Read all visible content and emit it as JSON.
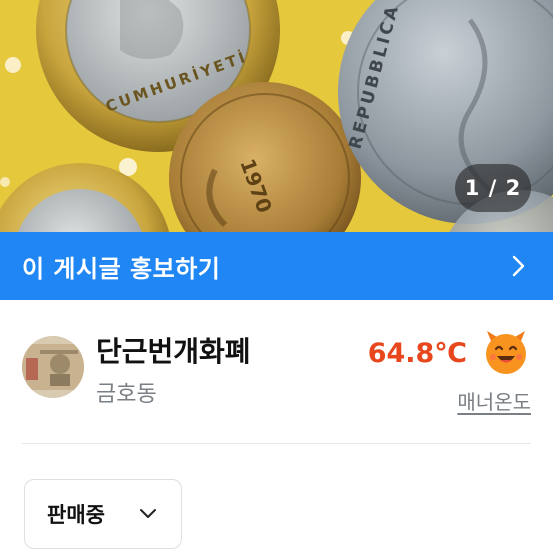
{
  "photo": {
    "counter": "1 / 2",
    "coin_texts": {
      "left_coin": "CUMHURİYETİ",
      "bottom_coin": "1970",
      "right_coin": "REPUBBLICA"
    }
  },
  "promo": {
    "label": "이 게시글 홍보하기",
    "icon": "chevron-right-icon"
  },
  "seller": {
    "name": "단근번개화폐",
    "location": "금호동",
    "temperature": "64.8℃",
    "temperature_icon": "happy-face-icon",
    "manner_label": "매너온도"
  },
  "status": {
    "selected": "판매중",
    "icon": "chevron-down-icon"
  },
  "colors": {
    "brand_blue": "#1f86f3",
    "temperature": "#e8461c",
    "photo_background": "#e8c93a"
  }
}
